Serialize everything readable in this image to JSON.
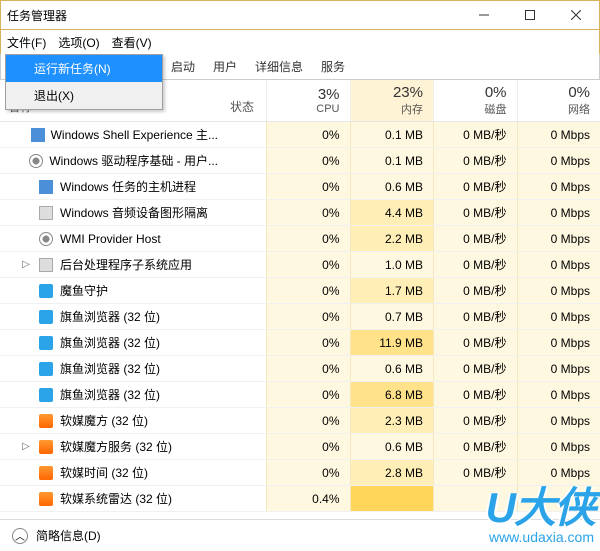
{
  "window": {
    "title": "任务管理器"
  },
  "menubar": {
    "file": "文件(F)",
    "options": "选项(O)",
    "view": "查看(V)"
  },
  "filemenu": {
    "run_new_task": "运行新任务(N)",
    "exit": "退出(X)"
  },
  "tabs": {
    "startup": "启动",
    "users": "用户",
    "details": "详细信息",
    "services": "服务"
  },
  "columns": {
    "name": "名称",
    "status": "状态",
    "cpu": {
      "pct": "3%",
      "label": "CPU"
    },
    "memory": {
      "pct": "23%",
      "label": "内存"
    },
    "disk": {
      "pct": "0%",
      "label": "磁盘"
    },
    "network": {
      "pct": "0%",
      "label": "网络"
    }
  },
  "processes": [
    {
      "name": "Windows Shell Experience 主...",
      "icon": "win",
      "cpu": "0%",
      "mem": "0.1 MB",
      "disk": "0 MB/秒",
      "net": "0 Mbps",
      "mem_lvl": 0
    },
    {
      "name": "Windows 驱动程序基础 - 用户...",
      "icon": "gear",
      "cpu": "0%",
      "mem": "0.1 MB",
      "disk": "0 MB/秒",
      "net": "0 Mbps",
      "mem_lvl": 0
    },
    {
      "name": "Windows 任务的主机进程",
      "icon": "win",
      "cpu": "0%",
      "mem": "0.6 MB",
      "disk": "0 MB/秒",
      "net": "0 Mbps",
      "mem_lvl": 0
    },
    {
      "name": "Windows 音频设备图形隔离",
      "icon": "app",
      "cpu": "0%",
      "mem": "4.4 MB",
      "disk": "0 MB/秒",
      "net": "0 Mbps",
      "mem_lvl": 1
    },
    {
      "name": "WMI Provider Host",
      "icon": "gear",
      "cpu": "0%",
      "mem": "2.2 MB",
      "disk": "0 MB/秒",
      "net": "0 Mbps",
      "mem_lvl": 1
    },
    {
      "name": "后台处理程序子系统应用",
      "icon": "app",
      "expandable": true,
      "cpu": "0%",
      "mem": "1.0 MB",
      "disk": "0 MB/秒",
      "net": "0 Mbps",
      "mem_lvl": 0
    },
    {
      "name": "魔鱼守护",
      "icon": "blue",
      "cpu": "0%",
      "mem": "1.7 MB",
      "disk": "0 MB/秒",
      "net": "0 Mbps",
      "mem_lvl": 1
    },
    {
      "name": "旗鱼浏览器 (32 位)",
      "icon": "blue",
      "cpu": "0%",
      "mem": "0.7 MB",
      "disk": "0 MB/秒",
      "net": "0 Mbps",
      "mem_lvl": 0
    },
    {
      "name": "旗鱼浏览器 (32 位)",
      "icon": "blue",
      "cpu": "0%",
      "mem": "11.9 MB",
      "disk": "0 MB/秒",
      "net": "0 Mbps",
      "mem_lvl": 2
    },
    {
      "name": "旗鱼浏览器 (32 位)",
      "icon": "blue",
      "cpu": "0%",
      "mem": "0.6 MB",
      "disk": "0 MB/秒",
      "net": "0 Mbps",
      "mem_lvl": 0
    },
    {
      "name": "旗鱼浏览器 (32 位)",
      "icon": "blue",
      "cpu": "0%",
      "mem": "6.8 MB",
      "disk": "0 MB/秒",
      "net": "0 Mbps",
      "mem_lvl": 2
    },
    {
      "name": "软媒魔方 (32 位)",
      "icon": "orange",
      "cpu": "0%",
      "mem": "2.3 MB",
      "disk": "0 MB/秒",
      "net": "0 Mbps",
      "mem_lvl": 1
    },
    {
      "name": "软媒魔方服务 (32 位)",
      "icon": "orange",
      "expandable": true,
      "cpu": "0%",
      "mem": "0.6 MB",
      "disk": "0 MB/秒",
      "net": "0 Mbps",
      "mem_lvl": 0
    },
    {
      "name": "软媒时间 (32 位)",
      "icon": "orange",
      "cpu": "0%",
      "mem": "2.8 MB",
      "disk": "0 MB/秒",
      "net": "0 Mbps",
      "mem_lvl": 1
    },
    {
      "name": "软媒系统雷达 (32 位)",
      "icon": "orange",
      "cpu": "0.4%",
      "mem": "",
      "disk": "",
      "net": "",
      "mem_lvl": 3
    }
  ],
  "footer": {
    "brief": "简略信息(D)"
  },
  "watermark": {
    "logo": "U大侠",
    "url": "www.udaxia.com"
  }
}
